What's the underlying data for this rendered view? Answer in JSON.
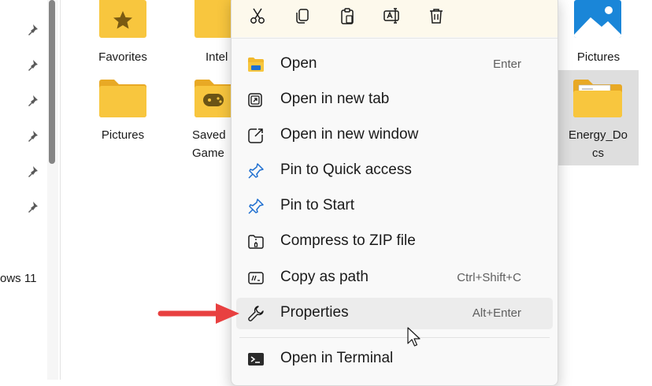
{
  "nav": {
    "partial_label": "ows 11"
  },
  "items": [
    {
      "label": "Favorites",
      "name": "folder-favorites"
    },
    {
      "label": "Intel",
      "name": "folder-intel"
    },
    {
      "label": "Pictures",
      "name": "folder-pictures"
    },
    {
      "label": "Saved",
      "label2": "Game",
      "name": "folder-saved-games"
    },
    {
      "label": "Pictures",
      "name": "folder-pictures-library"
    },
    {
      "label": "Energy_Do",
      "label2": "cs",
      "name": "folder-energy-docs"
    }
  ],
  "toolbar": {
    "cut": "cut-icon",
    "copy": "copy-icon",
    "paste": "paste-icon",
    "rename": "rename-icon",
    "delete": "delete-icon"
  },
  "menu": [
    {
      "label": "Open",
      "shortcut": "Enter",
      "icon": "folder-open-icon"
    },
    {
      "label": "Open in new tab",
      "shortcut": "",
      "icon": "new-tab-icon"
    },
    {
      "label": "Open in new window",
      "shortcut": "",
      "icon": "new-window-icon"
    },
    {
      "label": "Pin to Quick access",
      "shortcut": "",
      "icon": "pin-icon"
    },
    {
      "label": "Pin to Start",
      "shortcut": "",
      "icon": "pin-icon"
    },
    {
      "label": "Compress to ZIP file",
      "shortcut": "",
      "icon": "zip-icon"
    },
    {
      "label": "Copy as path",
      "shortcut": "Ctrl+Shift+C",
      "icon": "copy-path-icon"
    },
    {
      "label": "Properties",
      "shortcut": "Alt+Enter",
      "icon": "wrench-icon"
    },
    {
      "label": "Open in Terminal",
      "shortcut": "",
      "icon": "terminal-icon"
    }
  ],
  "colors": {
    "accent": "#e84040",
    "folder": "#f8c63e",
    "selection": "#dedede",
    "menu_bg": "#f9f9f9"
  }
}
